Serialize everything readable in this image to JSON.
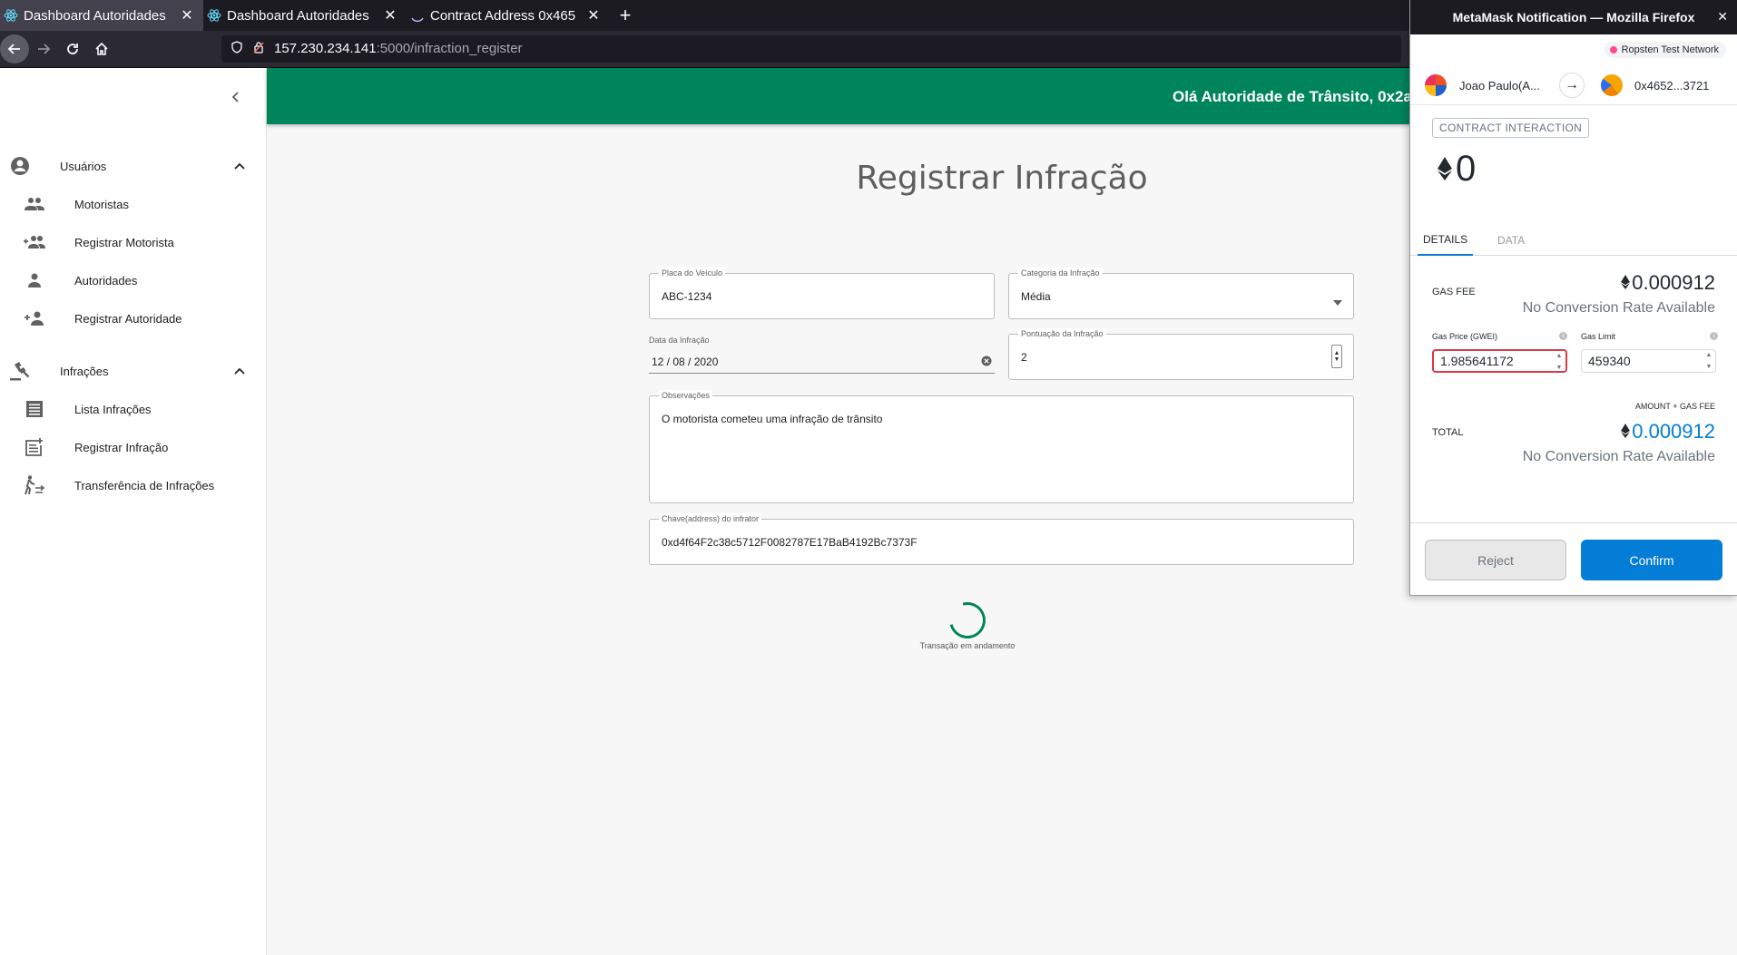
{
  "browser": {
    "tabs": [
      {
        "title": "Dashboard Autoridades",
        "active": true
      },
      {
        "title": "Dashboard Autoridades",
        "active": false
      },
      {
        "title": "Contract Address 0x465",
        "active": false
      }
    ],
    "url_host": "157.230.234.141",
    "url_path": ":5000/infraction_register"
  },
  "sidebar": {
    "groups": [
      {
        "label": "Usuários",
        "icon": "account-circle-icon",
        "items": [
          {
            "label": "Motoristas",
            "icon": "people-icon"
          },
          {
            "label": "Registrar Motorista",
            "icon": "group-add-icon"
          },
          {
            "label": "Autoridades",
            "icon": "person-icon"
          },
          {
            "label": "Registrar Autoridade",
            "icon": "person-add-icon"
          }
        ]
      },
      {
        "label": "Infrações",
        "icon": "gavel-icon",
        "items": [
          {
            "label": "Lista Infrações",
            "icon": "list-icon"
          },
          {
            "label": "Registrar Infração",
            "icon": "post-add-icon"
          },
          {
            "label": "Transferência de Infrações",
            "icon": "transfer-walk-icon"
          }
        ]
      }
    ]
  },
  "header": {
    "greeting": "Olá Autoridade de Trânsito, 0x2af",
    "color": "#00845a"
  },
  "form": {
    "title": "Registrar Infração",
    "plate": {
      "label": "Placa do Veículo",
      "value": "ABC-1234"
    },
    "category": {
      "label": "Categoria da Infração",
      "value": "Média"
    },
    "date": {
      "label": "Data da Infração",
      "value": "12 / 08 / 2020"
    },
    "points": {
      "label": "Pontuação da Infração",
      "value": "2"
    },
    "notes": {
      "label": "Observações",
      "value": "O motorista cometeu uma infração de trânsito"
    },
    "offender": {
      "label": "Chave(address) do infrator",
      "value": "0xd4f64F2c38c5712F0082787E17BaB4192Bc7373F"
    },
    "progress_text": "Transação em andamento"
  },
  "metamask": {
    "window_title": "MetaMask Notification — Mozilla Firefox",
    "network": "Ropsten Test Network",
    "from_account": "Joao Paulo(A...",
    "to_account": "0x4652...3721",
    "badge": "CONTRACT INTERACTION",
    "amount": "0",
    "tabs": [
      "DETAILS",
      "DATA"
    ],
    "gas_fee_label": "GAS FEE",
    "gas_fee_value": "0.000912",
    "no_conversion": "No Conversion Rate Available",
    "gas_price_label": "Gas Price (GWEI)",
    "gas_price_value": "1.985641172",
    "gas_limit_label": "Gas Limit",
    "gas_limit_value": "459340",
    "amount_gas_label": "AMOUNT + GAS FEE",
    "total_label": "TOTAL",
    "total_value": "0.000912",
    "reject_label": "Reject",
    "confirm_label": "Confirm",
    "accent": "#037dd6"
  }
}
